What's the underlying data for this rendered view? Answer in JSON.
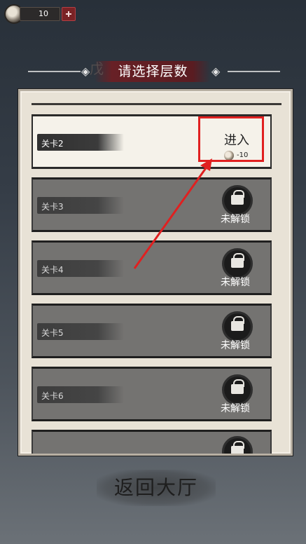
{
  "topbar": {
    "coin_count": "10",
    "coin_icon": "coin-icon",
    "plus_icon": "plus-icon"
  },
  "header": {
    "title": "请选择层数",
    "ghost_char": "戊"
  },
  "levels": [
    {
      "label": "关卡2",
      "state": "unlocked",
      "action": "进入",
      "cost": "-10"
    },
    {
      "label": "关卡3",
      "state": "locked",
      "status": "未解锁"
    },
    {
      "label": "关卡4",
      "state": "locked",
      "status": "未解锁"
    },
    {
      "label": "关卡5",
      "state": "locked",
      "status": "未解锁"
    },
    {
      "label": "关卡6",
      "state": "locked",
      "status": "未解锁"
    }
  ],
  "footer": {
    "back_label": "返回大厅"
  },
  "colors": {
    "highlight": "#e02020",
    "accent": "#7a2225"
  }
}
